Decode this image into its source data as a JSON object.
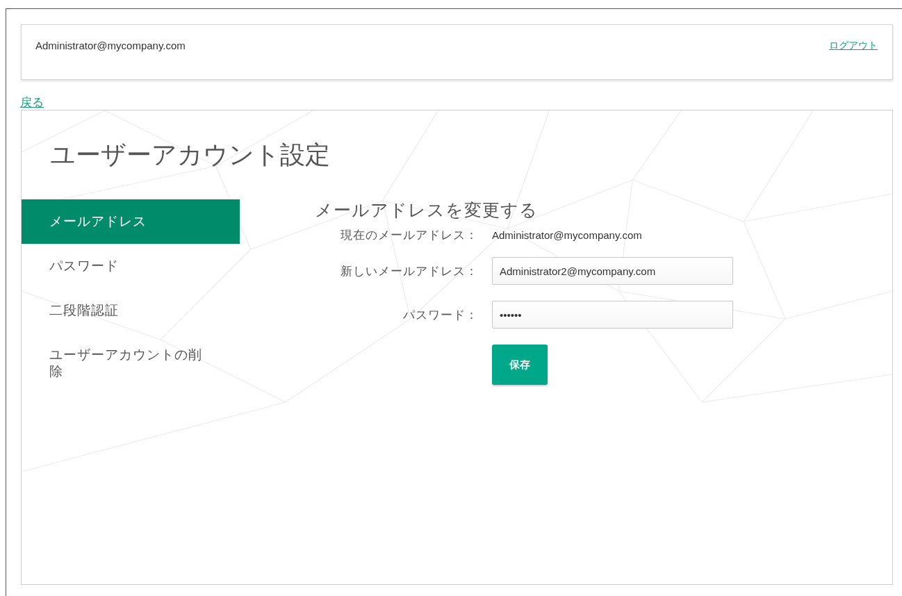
{
  "header": {
    "user": "Administrator@mycompany.com",
    "logout": "ログアウト"
  },
  "back_link": "戻る",
  "page_title": "ユーザーアカウント設定",
  "sidebar": {
    "items": [
      {
        "label": "メールアドレス",
        "selected": true
      },
      {
        "label": "パスワード",
        "selected": false
      },
      {
        "label": "二段階認証",
        "selected": false
      },
      {
        "label": "ユーザーアカウントの削除",
        "selected": false
      }
    ]
  },
  "form": {
    "title": "メールアドレスを変更する",
    "current_label": "現在のメールアドレス：",
    "current_value": "Administrator@mycompany.com",
    "fields": [
      {
        "label": "新しいメールアドレス：",
        "value": "Administrator2@mycompany.com"
      },
      {
        "label": "パスワード：",
        "value": "••••••"
      }
    ],
    "save_button": "保存"
  }
}
